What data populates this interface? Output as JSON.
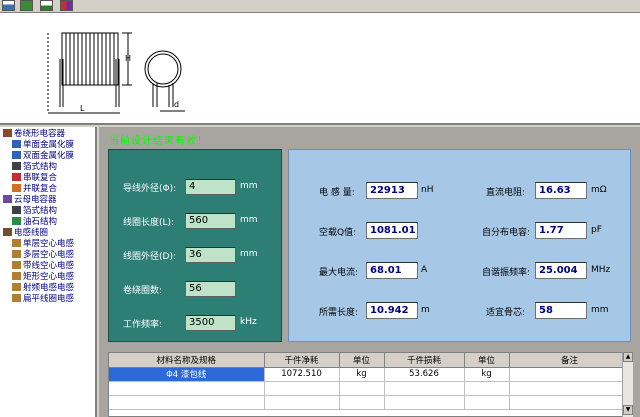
{
  "toolbar": {
    "icons": [
      "new-icon",
      "save-icon",
      "print-icon",
      "book-icon"
    ]
  },
  "diagram": {
    "label_height": "H",
    "label_length": "L",
    "label_diameter": "d"
  },
  "tree": {
    "items": [
      {
        "label": "卷绕形电容器",
        "level": 0,
        "icon": "capacitor-icon"
      },
      {
        "label": "单面金属化膜",
        "level": 1,
        "icon": "film-icon"
      },
      {
        "label": "双面金属化膜",
        "level": 1,
        "icon": "film-icon"
      },
      {
        "label": "箔式结构",
        "level": 1,
        "icon": "foil-icon"
      },
      {
        "label": "串联复合",
        "level": 1,
        "icon": "series-icon"
      },
      {
        "label": "并联复合",
        "level": 1,
        "icon": "parallel-icon"
      },
      {
        "label": "云母电容器",
        "level": 0,
        "icon": "mica-icon"
      },
      {
        "label": "箔式结构",
        "level": 1,
        "icon": "foil-icon"
      },
      {
        "label": "油石结构",
        "level": 1,
        "icon": "stone-icon"
      },
      {
        "label": "电感线圈",
        "level": 0,
        "icon": "inductor-icon"
      },
      {
        "label": "单层空心电感",
        "level": 1,
        "icon": "coil-icon"
      },
      {
        "label": "多层空心电感",
        "level": 1,
        "icon": "coil-icon"
      },
      {
        "label": "带线空心电感",
        "level": 1,
        "icon": "coil-icon"
      },
      {
        "label": "矩形空心电感",
        "level": 1,
        "icon": "coil-icon"
      },
      {
        "label": "射频电感电感",
        "level": 1,
        "icon": "coil-icon"
      },
      {
        "label": "扁平线圈电感",
        "level": 1,
        "icon": "coil-icon"
      }
    ]
  },
  "status": "当前设计结果有效！",
  "inputs": [
    {
      "label": "导线外径(Φ):",
      "value": "4",
      "unit": "mm"
    },
    {
      "label": "线圈长度(L):",
      "value": "560",
      "unit": "mm"
    },
    {
      "label": "线圈外径(D):",
      "value": "36",
      "unit": "mm"
    },
    {
      "label": "卷绕圈数:",
      "value": "56",
      "unit": ""
    },
    {
      "label": "工作频率:",
      "value": "3500",
      "unit": "kHz"
    }
  ],
  "outputs": {
    "inductance": {
      "label": "电 感 量:",
      "value": "22913",
      "unit": "nH"
    },
    "dc_resistance": {
      "label": "直流电阻:",
      "value": "16.63",
      "unit": "mΩ"
    },
    "q_value": {
      "label": "空载Q值:",
      "value": "1081.01",
      "unit": ""
    },
    "self_capacitance": {
      "label": "自分布电容:",
      "value": "1.77",
      "unit": "pF"
    },
    "max_current": {
      "label": "最大电流:",
      "value": "68.01",
      "unit": "A"
    },
    "self_resonant": {
      "label": "自谐振频率:",
      "value": "25.004",
      "unit": "MHz"
    },
    "wire_length": {
      "label": "所需长度:",
      "value": "10.942",
      "unit": "m"
    },
    "core_diameter": {
      "label": "适宜骨芯:",
      "value": "58",
      "unit": "mm"
    }
  },
  "table": {
    "headers": [
      "材料名称及规格",
      "千件净耗",
      "单位",
      "千件损耗",
      "单位",
      "备注"
    ],
    "rows": [
      [
        "Φ4 漆包线",
        "1072.510",
        "kg",
        "53.626",
        "kg",
        ""
      ],
      [
        "",
        "",
        "",
        "",
        "",
        ""
      ],
      [
        "",
        "",
        "",
        "",
        "",
        ""
      ]
    ]
  },
  "colors": {
    "input_panel": "#2d7f76",
    "output_panel": "#a6c8e6",
    "status_text": "#00ff00",
    "selection": "#2b6ad8"
  }
}
